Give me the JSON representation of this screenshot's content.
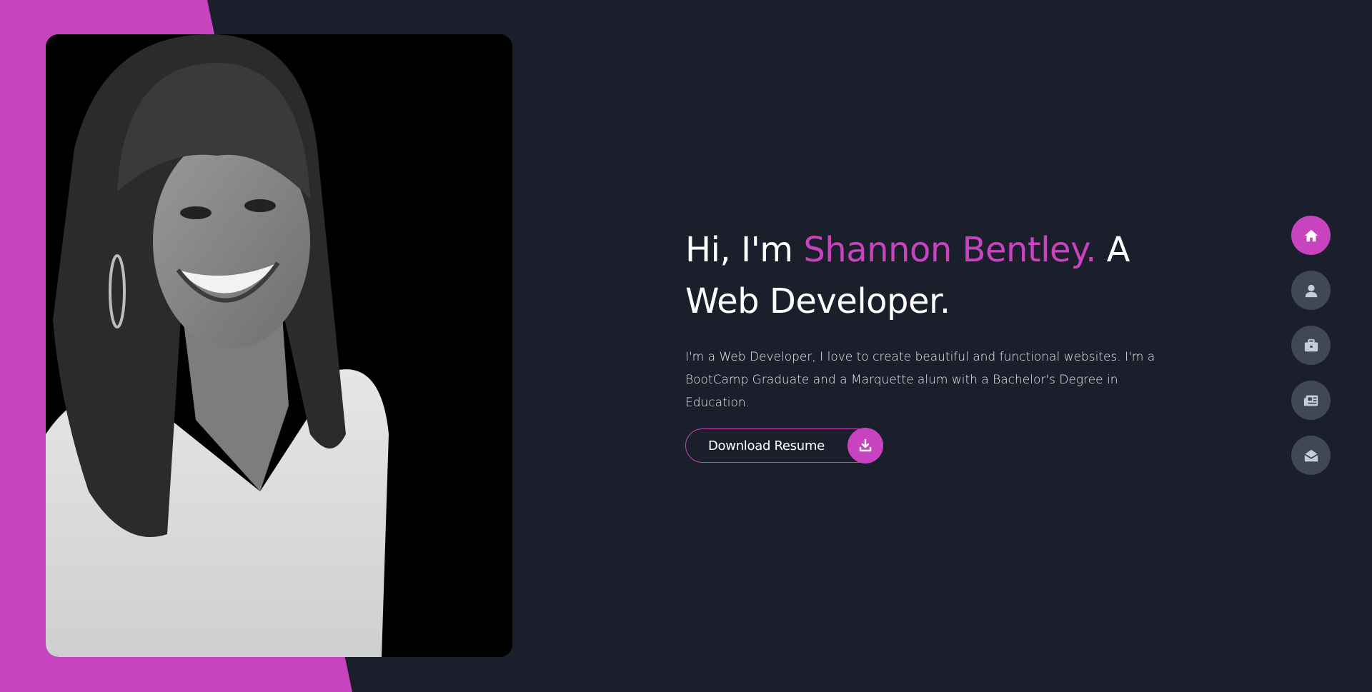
{
  "colors": {
    "background": "#1b1e2b",
    "accent": "#c843bf",
    "nav_inactive": "#414855",
    "text": "#ffffff"
  },
  "hero": {
    "greeting": "Hi, I'm ",
    "name": "Shannon Bentley.",
    "role": " A Web Developer.",
    "description": "I'm a Web Developer, I love to create beautiful and functional websites. I'm a BootCamp Graduate and a Marquette alum with a Bachelor's Degree in Education.",
    "download_label": "Download Resume",
    "download_icon": "download-icon"
  },
  "photo": {
    "alt": "Portrait photo"
  },
  "side_nav": {
    "items": [
      {
        "icon": "home-icon",
        "active": true
      },
      {
        "icon": "user-icon",
        "active": false
      },
      {
        "icon": "briefcase-icon",
        "active": false
      },
      {
        "icon": "newspaper-icon",
        "active": false
      },
      {
        "icon": "envelope-open-icon",
        "active": false
      }
    ]
  }
}
